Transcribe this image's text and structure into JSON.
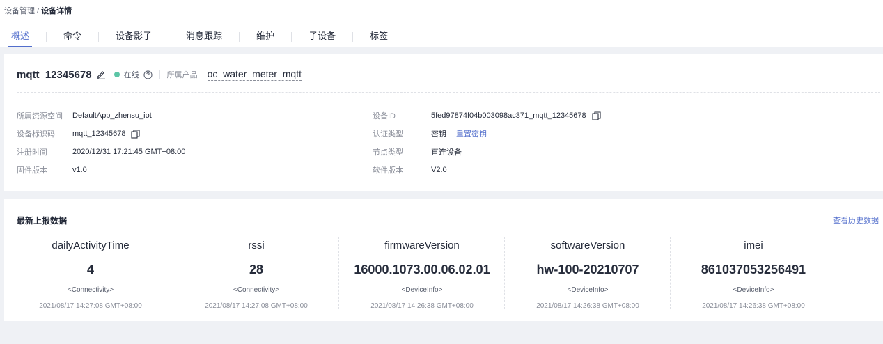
{
  "breadcrumb": {
    "parent": "设备管理",
    "separator": " / ",
    "current": "设备详情"
  },
  "tabs": [
    {
      "label": "概述",
      "active": true
    },
    {
      "label": "命令"
    },
    {
      "label": "设备影子"
    },
    {
      "label": "消息跟踪"
    },
    {
      "label": "维护"
    },
    {
      "label": "子设备"
    },
    {
      "label": "标签"
    }
  ],
  "device": {
    "name": "mqtt_12345678",
    "status": "在线",
    "status_color": "#5cc5a6",
    "product_label": "所属产品",
    "product_name": "oc_water_meter_mqtt"
  },
  "info": {
    "left": [
      {
        "label": "所属资源空间",
        "value": "DefaultApp_zhensu_iot"
      },
      {
        "label": "设备标识码",
        "value": "mqtt_12345678"
      },
      {
        "label": "注册时间",
        "value": "2020/12/31 17:21:45 GMT+08:00"
      },
      {
        "label": "固件版本",
        "value": "v1.0"
      }
    ],
    "right": [
      {
        "label": "设备ID",
        "value": "5fed97874f04b003098ac371_mqtt_12345678"
      },
      {
        "label": "认证类型",
        "value": "密钥",
        "link": "重置密钥"
      },
      {
        "label": "节点类型",
        "value": "直连设备"
      },
      {
        "label": "软件版本",
        "value": "V2.0"
      }
    ]
  },
  "report": {
    "title": "最新上报数据",
    "history_link": "查看历史数据",
    "metrics": [
      {
        "name": "dailyActivityTime",
        "value": "4",
        "category": "<Connectivity>",
        "time": "2021/08/17 14:27:08 GMT+08:00"
      },
      {
        "name": "rssi",
        "value": "28",
        "category": "<Connectivity>",
        "time": "2021/08/17 14:27:08 GMT+08:00"
      },
      {
        "name": "firmwareVersion",
        "value": "16000.1073.00.06.02.01",
        "category": "<DeviceInfo>",
        "time": "2021/08/17 14:26:38 GMT+08:00"
      },
      {
        "name": "softwareVersion",
        "value": "hw-100-20210707",
        "category": "<DeviceInfo>",
        "time": "2021/08/17 14:26:38 GMT+08:00"
      },
      {
        "name": "imei",
        "value": "861037053256491",
        "category": "<DeviceInfo>",
        "time": "2021/08/17 14:26:38 GMT+08:00"
      }
    ]
  },
  "colors": {
    "accent": "#526ecc",
    "online": "#5cc5a6"
  }
}
